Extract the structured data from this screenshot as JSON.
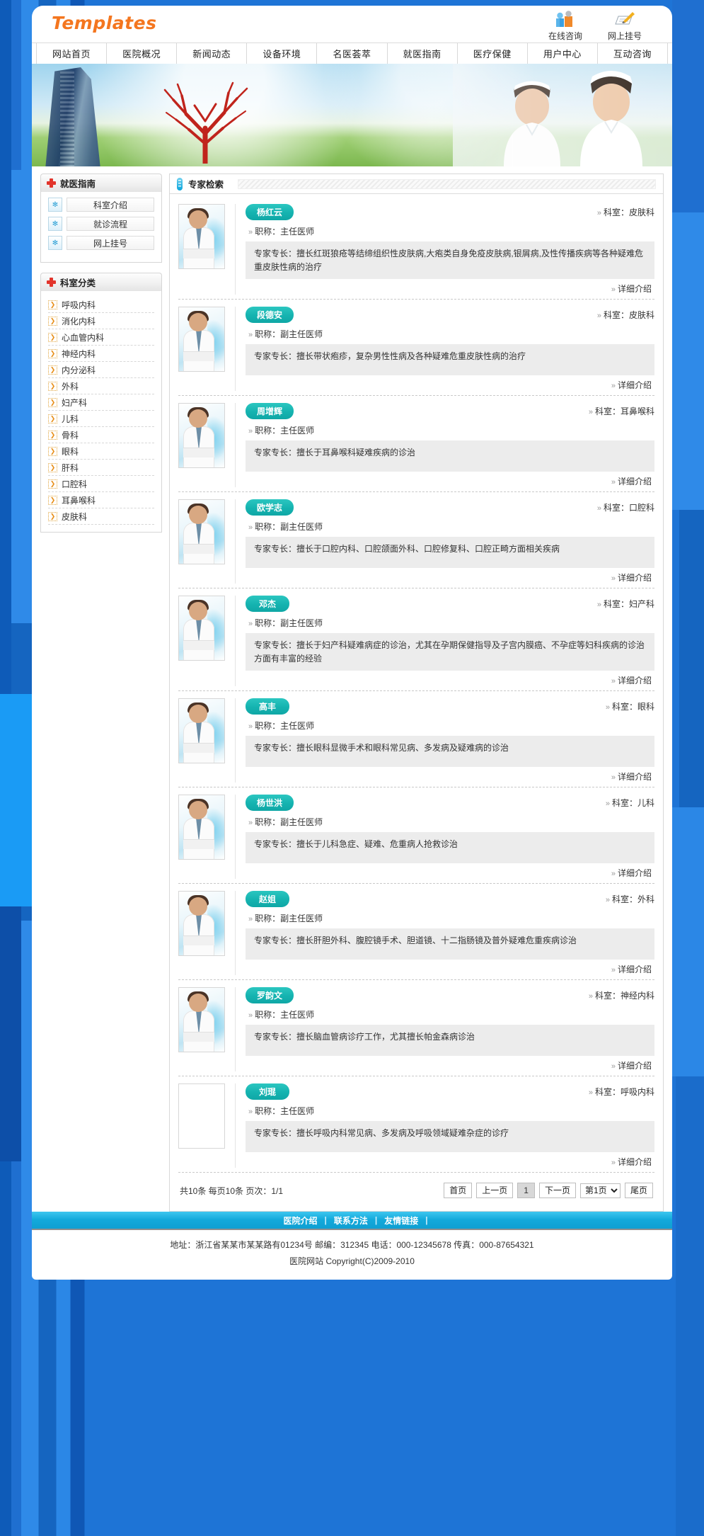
{
  "header": {
    "logo": "Templates",
    "tools": [
      {
        "icon": "consult-people-icon",
        "label": "在线咨询"
      },
      {
        "icon": "register-pencil-icon",
        "label": "网上挂号"
      }
    ]
  },
  "nav": {
    "items": [
      {
        "label": "网站首页"
      },
      {
        "label": "医院概况"
      },
      {
        "label": "新闻动态"
      },
      {
        "label": "设备环境"
      },
      {
        "label": "名医荟萃"
      },
      {
        "label": "就医指南"
      },
      {
        "label": "医疗保健"
      },
      {
        "label": "用户中心"
      },
      {
        "label": "互动咨询"
      }
    ]
  },
  "sidebar": {
    "guide_panel": {
      "title": "就医指南",
      "icon": "red-cross-icon",
      "items": [
        {
          "label": "科室介绍",
          "icon": "blue-square-icon"
        },
        {
          "label": "就诊流程",
          "icon": "blue-square-icon"
        },
        {
          "label": "网上挂号",
          "icon": "blue-square-icon"
        }
      ]
    },
    "dept_panel": {
      "title": "科室分类",
      "icon": "red-cross-icon",
      "items": [
        {
          "label": "呼吸内科"
        },
        {
          "label": "消化内科"
        },
        {
          "label": "心血管内科"
        },
        {
          "label": "神经内科"
        },
        {
          "label": "内分泌科"
        },
        {
          "label": "外科"
        },
        {
          "label": "妇产科"
        },
        {
          "label": "儿科"
        },
        {
          "label": "骨科"
        },
        {
          "label": "眼科"
        },
        {
          "label": "肝科"
        },
        {
          "label": "口腔科"
        },
        {
          "label": "耳鼻喉科"
        },
        {
          "label": "皮肤科"
        }
      ]
    }
  },
  "main": {
    "title": "专家检索",
    "title_icon": "capsule-icon",
    "detail_link_label": "详细介绍",
    "dept_prefix": "科室：",
    "title_prefix": "职称：",
    "doctors": [
      {
        "name": "杨红云",
        "dept": "科室：皮肤科",
        "title": "职称：主任医师",
        "specialty": "专家专长：擅长红斑狼疮等结缔组织性皮肤病,大疱类自身免疫皮肤病,银屑病,及性传播疾病等各种疑难危重皮肤性病的治疗",
        "has_photo": true
      },
      {
        "name": "段德安",
        "dept": "科室：皮肤科",
        "title": "职称：副主任医师",
        "specialty": "专家专长：擅长带状疱疹，复杂男性性病及各种疑难危重皮肤性病的治疗",
        "has_photo": true
      },
      {
        "name": "周增辉",
        "dept": "科室：耳鼻喉科",
        "title": "职称：主任医师",
        "specialty": "专家专长：擅长于耳鼻喉科疑难疾病的诊治",
        "has_photo": true
      },
      {
        "name": "欧学志",
        "dept": "科室：口腔科",
        "title": "职称：副主任医师",
        "specialty": "专家专长：擅长于口腔内科、口腔颌面外科、口腔修复科、口腔正畸方面相关疾病",
        "has_photo": true
      },
      {
        "name": "邓杰",
        "dept": "科室：妇产科",
        "title": "职称：副主任医师",
        "specialty": "专家专长：擅长于妇产科疑难病症的诊治，尤其在孕期保健指导及子宫内膜癌、不孕症等妇科疾病的诊治方面有丰富的经验",
        "has_photo": true
      },
      {
        "name": "高丰",
        "dept": "科室：眼科",
        "title": "职称：主任医师",
        "specialty": "专家专长：擅长眼科显微手术和眼科常见病、多发病及疑难病的诊治",
        "has_photo": true
      },
      {
        "name": "杨世洪",
        "dept": "科室：儿科",
        "title": "职称：副主任医师",
        "specialty": "专家专长：擅长于儿科急症、疑难、危重病人抢救诊治",
        "has_photo": true
      },
      {
        "name": "赵姐",
        "dept": "科室：外科",
        "title": "职称：副主任医师",
        "specialty": "专家专长：擅长肝胆外科、腹腔镜手术、胆道镜、十二指肠镜及普外疑难危重疾病诊治",
        "has_photo": true
      },
      {
        "name": "罗韵文",
        "dept": "科室：神经内科",
        "title": "职称：主任医师",
        "specialty": "专家专长：擅长脑血管病诊疗工作，尤其擅长帕金森病诊治",
        "has_photo": true
      },
      {
        "name": "刘琨",
        "dept": "科室：呼吸内科",
        "title": "职称：主任医师",
        "specialty": "专家专长：擅长呼吸内科常见病、多发病及呼吸领域疑难杂症的诊疗",
        "has_photo": false
      }
    ]
  },
  "pager": {
    "summary": "共10条 每页10条 页次：1/1",
    "first": "首页",
    "prev": "上一页",
    "current": "1",
    "next": "下一页",
    "select_value": "第1页",
    "last": "尾页"
  },
  "footer": {
    "links": [
      "医院介绍",
      "联系方法",
      "友情链接"
    ],
    "address": "地址：浙江省某某市某某路有01234号 邮编：312345 电话：000-12345678 传真：000-87654321",
    "copyright": "医院网站 Copyright(C)2009-2010"
  },
  "colors": {
    "brand_orange": "#F4761F",
    "accent_teal": "#15b3b0",
    "footer_blue": "#12a9db",
    "page_blue": "#1e74d6",
    "cross_red": "#E2342B"
  }
}
